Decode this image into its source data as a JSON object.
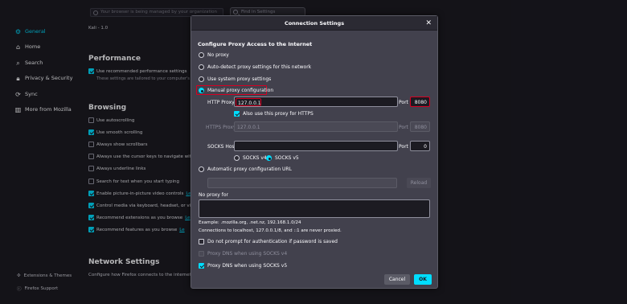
{
  "background": {
    "policy_notice": "Your browser is being managed by your organization",
    "find_placeholder": "Find in Settings",
    "version_text": "Kali - 1.0",
    "sidebar": {
      "items": [
        {
          "label": "General",
          "icon": "gear-icon",
          "active": true
        },
        {
          "label": "Home",
          "icon": "home-icon"
        },
        {
          "label": "Search",
          "icon": "search-icon"
        },
        {
          "label": "Privacy & Security",
          "icon": "lock-icon"
        },
        {
          "label": "Sync",
          "icon": "sync-icon"
        },
        {
          "label": "More from Mozilla",
          "icon": "mozilla-icon"
        }
      ],
      "extensions_label": "Extensions & Themes",
      "support_label": "Firefox Support"
    },
    "performance": {
      "title": "Performance",
      "recommended_label": "Use recommended performance settings",
      "recommended_note": "These settings are tailored to your computer's h"
    },
    "browsing": {
      "title": "Browsing",
      "options": [
        {
          "label": "Use autoscrolling",
          "checked": false
        },
        {
          "label": "Use smooth scrolling",
          "checked": true
        },
        {
          "label": "Always show scrollbars",
          "checked": false
        },
        {
          "label": "Always use the cursor keys to navigate withi",
          "checked": false
        },
        {
          "label": "Always underline links",
          "checked": false
        },
        {
          "label": "Search for text when you start typing",
          "checked": false
        },
        {
          "label": "Enable picture-in-picture video controls",
          "checked": true,
          "link": "Le"
        },
        {
          "label": "Control media via keyboard, headset, or virt",
          "checked": true
        },
        {
          "label": "Recommend extensions as you browse",
          "checked": true,
          "link": "Le"
        },
        {
          "label": "Recommend features as you browse",
          "checked": true,
          "link": "Le"
        }
      ]
    },
    "network": {
      "title": "Network Settings",
      "description": "Configure how Firefox connects to the internet."
    }
  },
  "dialog": {
    "title": "Connection Settings",
    "heading": "Configure Proxy Access to the Internet",
    "options": {
      "no_proxy": "No proxy",
      "auto_detect": "Auto-detect proxy settings for this network",
      "system": "Use system proxy settings",
      "manual": "Manual proxy configuration",
      "auto_url": "Automatic proxy configuration URL"
    },
    "selected_option": "manual",
    "http_proxy_label": "HTTP Proxy",
    "http_proxy_value": "127.0.0.1",
    "http_port_label": "Port",
    "http_port_value": "8080",
    "also_https_label": "Also use this proxy for HTTPS",
    "also_https_checked": true,
    "https_proxy_label": "HTTPS Proxy",
    "https_proxy_value": "127.0.0.1",
    "https_port_label": "Port",
    "https_port_value": "8080",
    "socks_host_label": "SOCKS Host",
    "socks_host_value": "",
    "socks_port_label": "Port",
    "socks_port_value": "0",
    "socks_v4_label": "SOCKS v4",
    "socks_v5_label": "SOCKS v5",
    "socks_selected": "v5",
    "reload_label": "Reload",
    "no_proxy_for_label": "No proxy for",
    "no_proxy_value": "",
    "example_text": "Example: .mozilla.org, .net.nz, 192.168.1.0/24",
    "localhost_text": "Connections to localhost, 127.0.0.1/8, and ::1 are never proxied.",
    "no_prompt_label": "Do not prompt for authentication if password is saved",
    "no_prompt_checked": false,
    "dns_socks4_label": "Proxy DNS when using SOCKS v4",
    "dns_socks4_checked": false,
    "dns_socks5_label": "Proxy DNS when using SOCKS v5",
    "dns_socks5_checked": true,
    "cancel_label": "Cancel",
    "ok_label": "OK"
  },
  "colors": {
    "accent": "#00ddff",
    "highlight_border": "#d70022",
    "dialog_bg": "#42414d",
    "page_bg": "#1c1b22"
  }
}
